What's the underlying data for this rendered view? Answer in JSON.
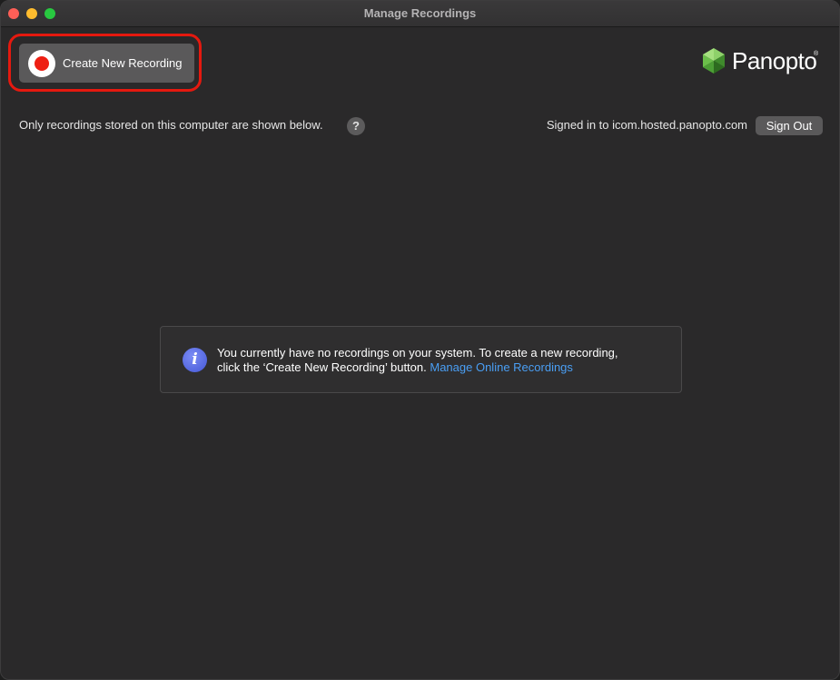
{
  "window": {
    "title": "Manage Recordings"
  },
  "toolbar": {
    "create_label": "Create New Recording",
    "logo_text": "Panopto",
    "logo_tm": "®"
  },
  "status": {
    "local_notice": "Only recordings stored on this computer are shown below.",
    "help_label": "?",
    "signed_in_text": "Signed in to icom.hosted.panopto.com",
    "signout_label": "Sign Out"
  },
  "empty_state": {
    "message_line1": "You currently have no recordings on your system. To create a new recording,",
    "message_line2": "click the ‘Create New Recording’ button.",
    "link_label": "Manage Online Recordings",
    "icon_glyph": "i"
  },
  "colors": {
    "record_red": "#ee1f13",
    "highlight_red": "#e5190f",
    "link_blue": "#4a9ff5",
    "background": "#2a292a"
  }
}
